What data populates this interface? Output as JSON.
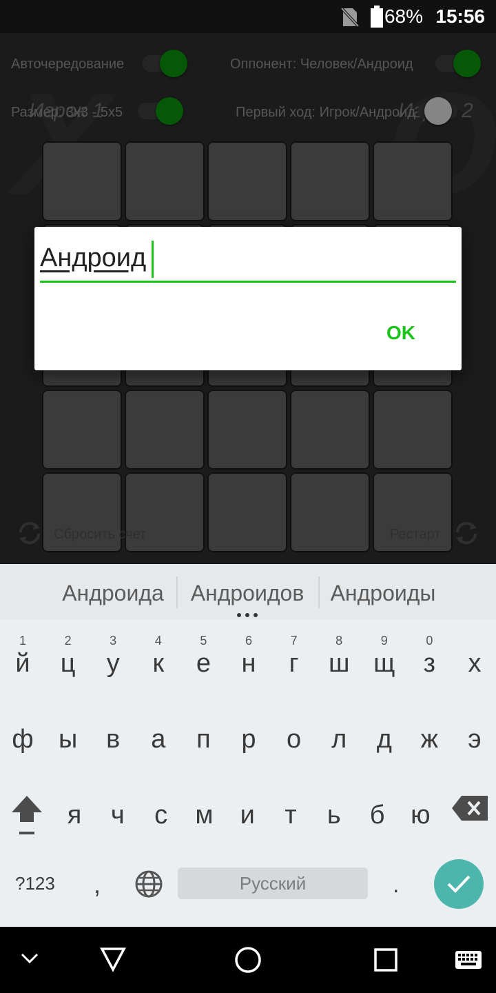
{
  "status_bar": {
    "battery": "68%",
    "time": "15:56"
  },
  "settings": {
    "auto_alternate_label": "Авточередование",
    "opponent_label": "Оппонент: Человек/Андроид",
    "size_label": "Размер: 3x3 - 5x5",
    "first_move_label": "Первый ход: Игрок/Андроид"
  },
  "players": {
    "player1": "Игрок 1",
    "player2": "Игрок 2"
  },
  "background_marks": {
    "left": "X",
    "right": "O"
  },
  "board": {
    "rows": 5,
    "cols": 5
  },
  "bottom_actions": {
    "reset_score": "Сбросить счет",
    "restart": "Рестарт"
  },
  "dialog": {
    "input_value": "Андроид",
    "ok_label": "OK"
  },
  "keyboard": {
    "suggestions": [
      "Андроида",
      "Андроидов",
      "Андроиды"
    ],
    "row1": [
      {
        "num": "1",
        "ch": "й"
      },
      {
        "num": "2",
        "ch": "ц"
      },
      {
        "num": "3",
        "ch": "у"
      },
      {
        "num": "4",
        "ch": "к"
      },
      {
        "num": "5",
        "ch": "е"
      },
      {
        "num": "6",
        "ch": "н"
      },
      {
        "num": "7",
        "ch": "г"
      },
      {
        "num": "8",
        "ch": "ш"
      },
      {
        "num": "9",
        "ch": "щ"
      },
      {
        "num": "0",
        "ch": "з"
      },
      {
        "num": "",
        "ch": "х"
      }
    ],
    "row2": [
      "ф",
      "ы",
      "в",
      "а",
      "п",
      "р",
      "о",
      "л",
      "д",
      "ж",
      "э"
    ],
    "row3": [
      "я",
      "ч",
      "с",
      "м",
      "и",
      "т",
      "ь",
      "б",
      "ю"
    ],
    "symbols_label": "?123",
    "comma": ",",
    "space_label": "Русский",
    "period": "."
  },
  "colors": {
    "accent_green": "#19c419",
    "toggle_on": "#0a8f0a",
    "enter_key": "#4db6ac"
  }
}
